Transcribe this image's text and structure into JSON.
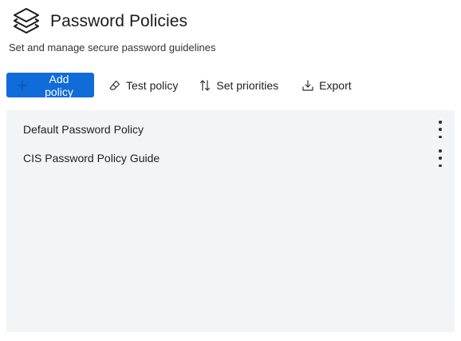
{
  "header": {
    "title": "Password Policies",
    "subtitle": "Set and manage secure password guidelines",
    "icon": "layers-icon"
  },
  "toolbar": {
    "add_label": "Add policy",
    "test_label": "Test policy",
    "priorities_label": "Set priorities",
    "export_label": "Export",
    "accent_color": "#0f6cd9"
  },
  "policies": [
    {
      "label": "Default Password Policy"
    },
    {
      "label": "CIS Password Policy Guide"
    }
  ]
}
